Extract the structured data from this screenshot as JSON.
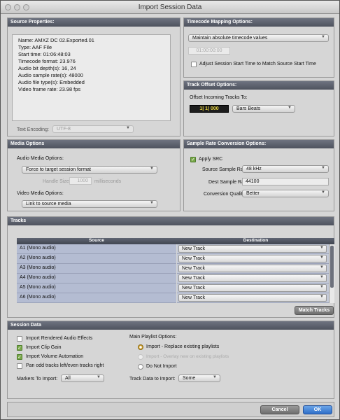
{
  "window": {
    "title": "Import Session Data"
  },
  "source": {
    "header": "Source Properties:",
    "lines": [
      "Name: AMXZ DC 02.Exported.01",
      "Type: AAF File",
      "Start time: 01:06:48:03",
      "Timecode format: 23.976",
      "Audio bit depth(s): 16, 24",
      "Audio sample rate(s): 48000",
      "Audio file type(s): Embedded",
      "Video frame rate: 23.98 fps"
    ],
    "text_encoding_label": "Text Encoding:",
    "text_encoding_value": "UTF-8"
  },
  "timecode": {
    "header": "Timecode Mapping Options:",
    "mapping": "Maintain absolute timecode values",
    "timecode_value": "01:00:00:00",
    "adjust_label": "Adjust Session Start Time to Match Source Start Time",
    "adjust_checked": false
  },
  "track_offset": {
    "header": "Track Offset Options:",
    "offset_label": "Offset Incoming Tracks To:",
    "offset_value": "1| 1| 000",
    "offset_unit": "Bars Beats"
  },
  "media": {
    "header": "Media Options",
    "audio_label": "Audio Media Options:",
    "audio_value": "Force to target session format",
    "handle_label": "Handle Size:",
    "handle_value": "1000",
    "handle_unit": "milliseconds",
    "video_label": "Video Media Options:",
    "video_value": "Link to source media"
  },
  "src": {
    "header": "Sample Rate Conversion Options:",
    "apply_label": "Apply SRC",
    "apply_checked": true,
    "source_rate_label": "Source Sample Rate:",
    "source_rate_value": "48 kHz",
    "dest_rate_label": "Dest Sample Rate:",
    "dest_rate_value": "44100",
    "quality_label": "Conversion Quality:",
    "quality_value": "Better"
  },
  "tracks": {
    "header": "Tracks",
    "col_source": "Source",
    "col_destination": "Destination",
    "rows": [
      {
        "source": "A1 (Mono audio)",
        "destination": "New Track"
      },
      {
        "source": "A2 (Mono audio)",
        "destination": "New Track"
      },
      {
        "source": "A3 (Mono audio)",
        "destination": "New Track"
      },
      {
        "source": "A4 (Mono audio)",
        "destination": "New Track"
      },
      {
        "source": "A5 (Mono audio)",
        "destination": "New Track"
      },
      {
        "source": "A6 (Mono audio)",
        "destination": "New Track"
      }
    ],
    "match_button": "Match Tracks"
  },
  "session_data": {
    "header": "Session Data",
    "checks": [
      {
        "label": "Import Rendered Audio Effects",
        "checked": false
      },
      {
        "label": "Import Clip Gain",
        "checked": true
      },
      {
        "label": "Import Volume Automation",
        "checked": true
      },
      {
        "label": "Pan odd tracks left/even tracks right",
        "checked": false
      }
    ],
    "markers_label": "Markers To Import:",
    "markers_value": "All",
    "playlist_label": "Main Playlist Options:",
    "playlist_options": [
      {
        "label": "Import - Replace existing playlists",
        "selected": true,
        "disabled": false
      },
      {
        "label": "Import - Overlay new on existing playlists",
        "selected": false,
        "disabled": true
      },
      {
        "label": "Do Not Import",
        "selected": false,
        "disabled": false
      }
    ],
    "track_data_label": "Track Data to Import:",
    "track_data_value": "Some"
  },
  "buttons": {
    "cancel": "Cancel",
    "ok": "OK"
  }
}
